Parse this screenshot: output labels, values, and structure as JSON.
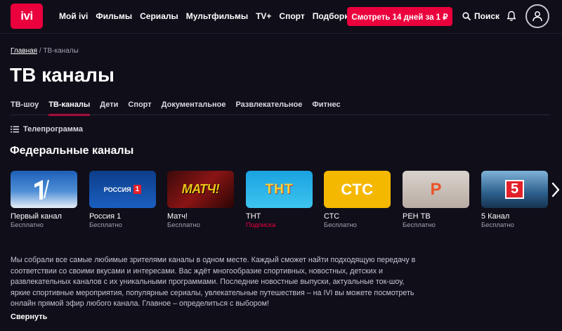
{
  "header": {
    "logo_text": "ivi",
    "nav": [
      "Мой ivi",
      "Фильмы",
      "Сериалы",
      "Мультфильмы",
      "TV+",
      "Спорт",
      "Подборки"
    ],
    "cta_label": "Смотреть 14 дней за 1 ₽",
    "search_label": "Поиск"
  },
  "breadcrumb": {
    "home": "Главная",
    "separator": " / ",
    "current": "ТВ-каналы"
  },
  "page_title": "ТВ каналы",
  "tabs": [
    "ТВ-шоу",
    "ТВ-каналы",
    "Дети",
    "Спорт",
    "Документальное",
    "Развлекательное",
    "Фитнес"
  ],
  "active_tab": "ТВ-каналы",
  "tv_program_label": "Телепрограмма",
  "section_title": "Федеральные каналы",
  "channels": [
    {
      "name": "Первый канал",
      "status": "Бесплатно",
      "logo_text": "1"
    },
    {
      "name": "Россия 1",
      "status": "Бесплатно",
      "logo_text": "РОССИЯ 1"
    },
    {
      "name": "Матч!",
      "status": "Бесплатно",
      "logo_text": "МАТЧ!"
    },
    {
      "name": "ТНТ",
      "status": "Подписка",
      "logo_text": "ТНТ"
    },
    {
      "name": "СТС",
      "status": "Бесплатно",
      "logo_text": "СТС"
    },
    {
      "name": "РЕН ТВ",
      "status": "Бесплатно",
      "logo_text": "Р"
    },
    {
      "name": "5 Канал",
      "status": "Бесплатно",
      "logo_text": "5"
    }
  ],
  "description": "Мы собрали все самые любимые зрителями каналы в одном месте. Каждый сможет найти подходящую передачу в соответствии со своими вкусами и интересами. Вас ждёт многообразие спортивных, новостных, детских и развлекательных каналов с их уникальными программами. Последние новостные выпуски, актуальные ток-шоу, яркие спортивные мероприятия, популярные сериалы, увлекательные путешествия – на IVI вы можете посмотреть онлайн прямой эфир любого канала. Главное – определиться с выбором!",
  "collapse_label": "Свернуть",
  "colors": {
    "accent": "#ea003d",
    "background": "#100e19",
    "muted_text": "#a5a1b2"
  }
}
